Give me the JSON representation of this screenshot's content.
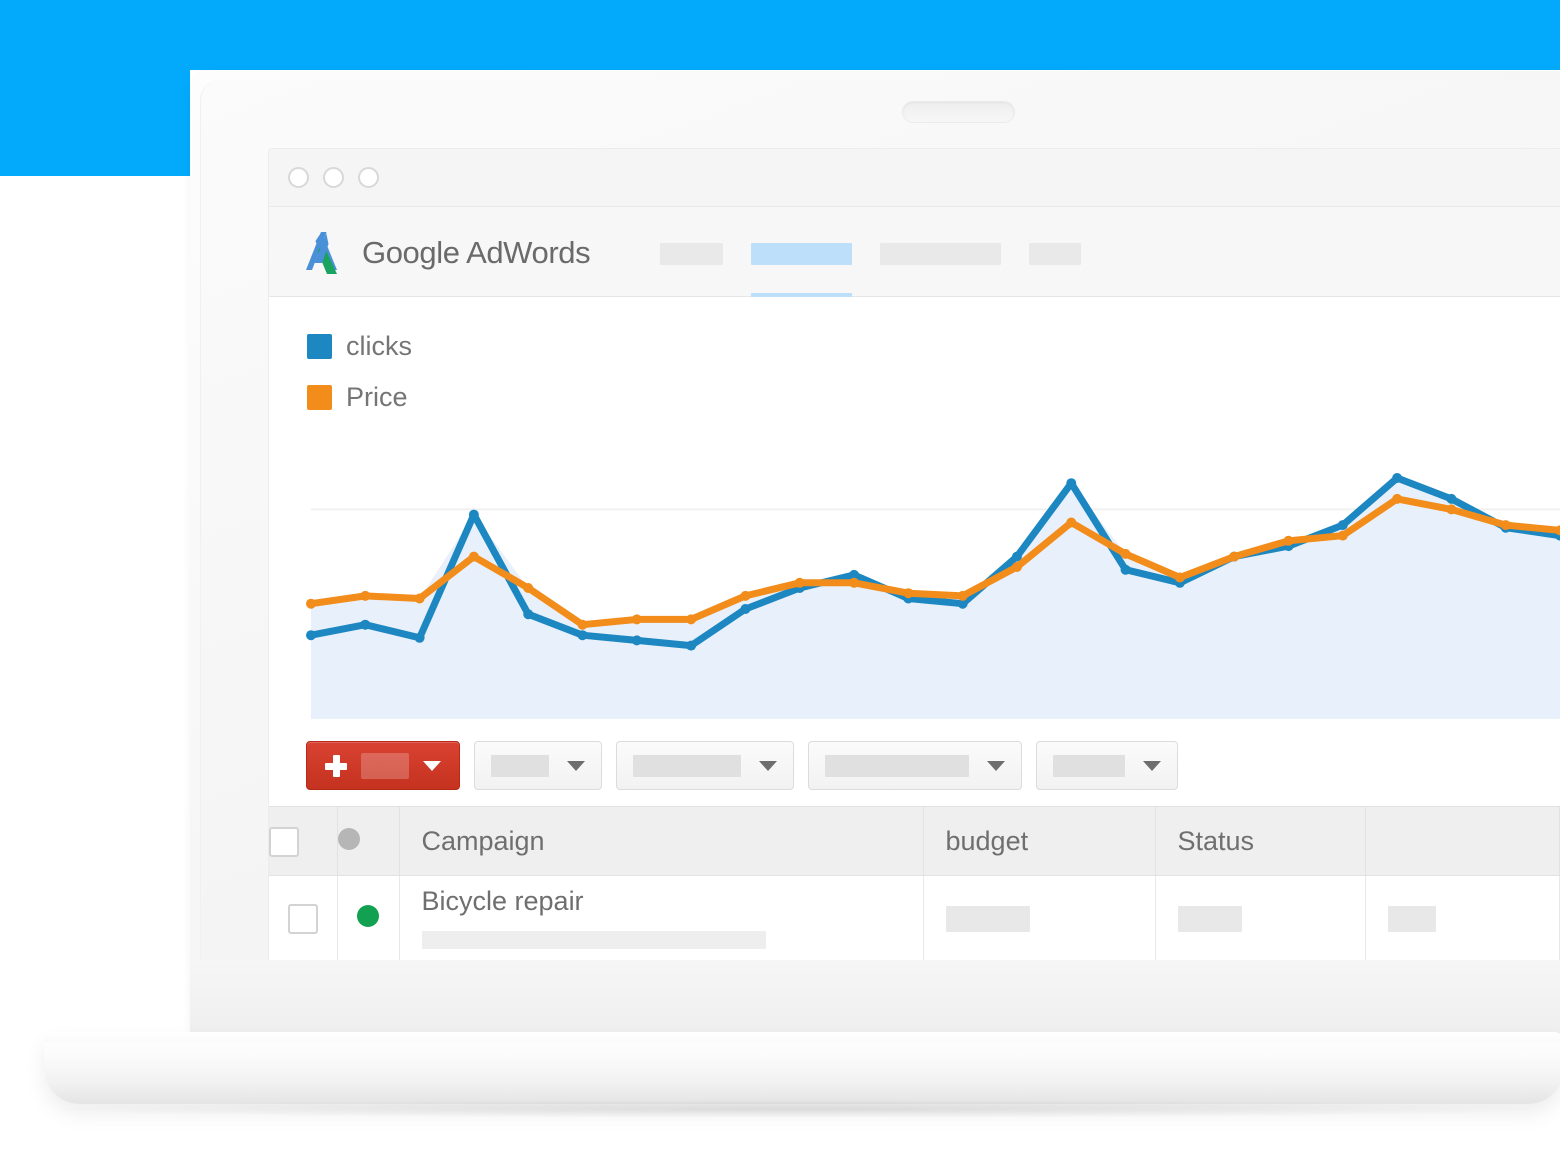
{
  "background": {
    "accent_blue": "#03aafc"
  },
  "window": {
    "traffic_lights": [
      "close-dot",
      "minimize-dot",
      "maximize-dot"
    ]
  },
  "app": {
    "brand_name": "Google AdWords",
    "logo_icon": "adwords-logo-icon",
    "nav_items": [
      {
        "name": "nav-tab-1",
        "label": "",
        "active": false
      },
      {
        "name": "nav-tab-2",
        "label": "",
        "active": true
      },
      {
        "name": "nav-tab-3",
        "label": "",
        "active": false
      },
      {
        "name": "nav-tab-4",
        "label": "",
        "active": false
      }
    ]
  },
  "chart_panel": {
    "legend": [
      {
        "label": "clicks",
        "color": "#1c87c0"
      },
      {
        "label": "Price",
        "color": "#f28c1b"
      }
    ]
  },
  "chart_data": {
    "type": "line",
    "title": "",
    "xlabel": "",
    "ylabel": "",
    "grid": true,
    "gridlines_y": [
      80
    ],
    "legend_position": "top-left",
    "area_fill": "#e8f0fb",
    "x": [
      0,
      1,
      2,
      3,
      4,
      5,
      6,
      7,
      8,
      9,
      10,
      11,
      12,
      13,
      14,
      15,
      16,
      17,
      18,
      19,
      20,
      21,
      22,
      23
    ],
    "ylim": [
      0,
      100
    ],
    "series": [
      {
        "name": "clicks",
        "color": "#1c87c0",
        "values": [
          32,
          36,
          31,
          78,
          40,
          32,
          30,
          28,
          42,
          50,
          55,
          46,
          44,
          62,
          90,
          57,
          52,
          62,
          66,
          74,
          92,
          84,
          73,
          70
        ]
      },
      {
        "name": "Price",
        "color": "#f28c1b",
        "values": [
          44,
          47,
          46,
          62,
          50,
          36,
          38,
          38,
          47,
          52,
          52,
          48,
          47,
          58,
          75,
          63,
          54,
          62,
          68,
          70,
          84,
          80,
          74,
          72
        ]
      }
    ]
  },
  "toolbar": {
    "add_button": {
      "name": "add-campaign-button",
      "plus_icon": "plus-icon",
      "caret_icon": "chevron-down-icon"
    },
    "dropdowns": [
      {
        "name": "filter-dropdown-1",
        "pill_width": 58,
        "caret_icon": "chevron-down-icon"
      },
      {
        "name": "filter-dropdown-2",
        "pill_width": 108,
        "caret_icon": "chevron-down-icon"
      },
      {
        "name": "filter-dropdown-3",
        "pill_width": 144,
        "caret_icon": "chevron-down-icon"
      },
      {
        "name": "filter-dropdown-4",
        "pill_width": 72,
        "caret_icon": "chevron-down-icon"
      }
    ]
  },
  "table": {
    "columns": [
      {
        "key": "select",
        "label": ""
      },
      {
        "key": "status_dot",
        "label": ""
      },
      {
        "key": "campaign",
        "label": "Campaign"
      },
      {
        "key": "budget",
        "label": "budget"
      },
      {
        "key": "status",
        "label": "Status"
      },
      {
        "key": "extra",
        "label": ""
      }
    ],
    "rows": [
      {
        "selected": false,
        "status_color": "#12a150",
        "campaign": "Bicycle repair",
        "budget": "",
        "status": "",
        "extra": ""
      }
    ]
  }
}
